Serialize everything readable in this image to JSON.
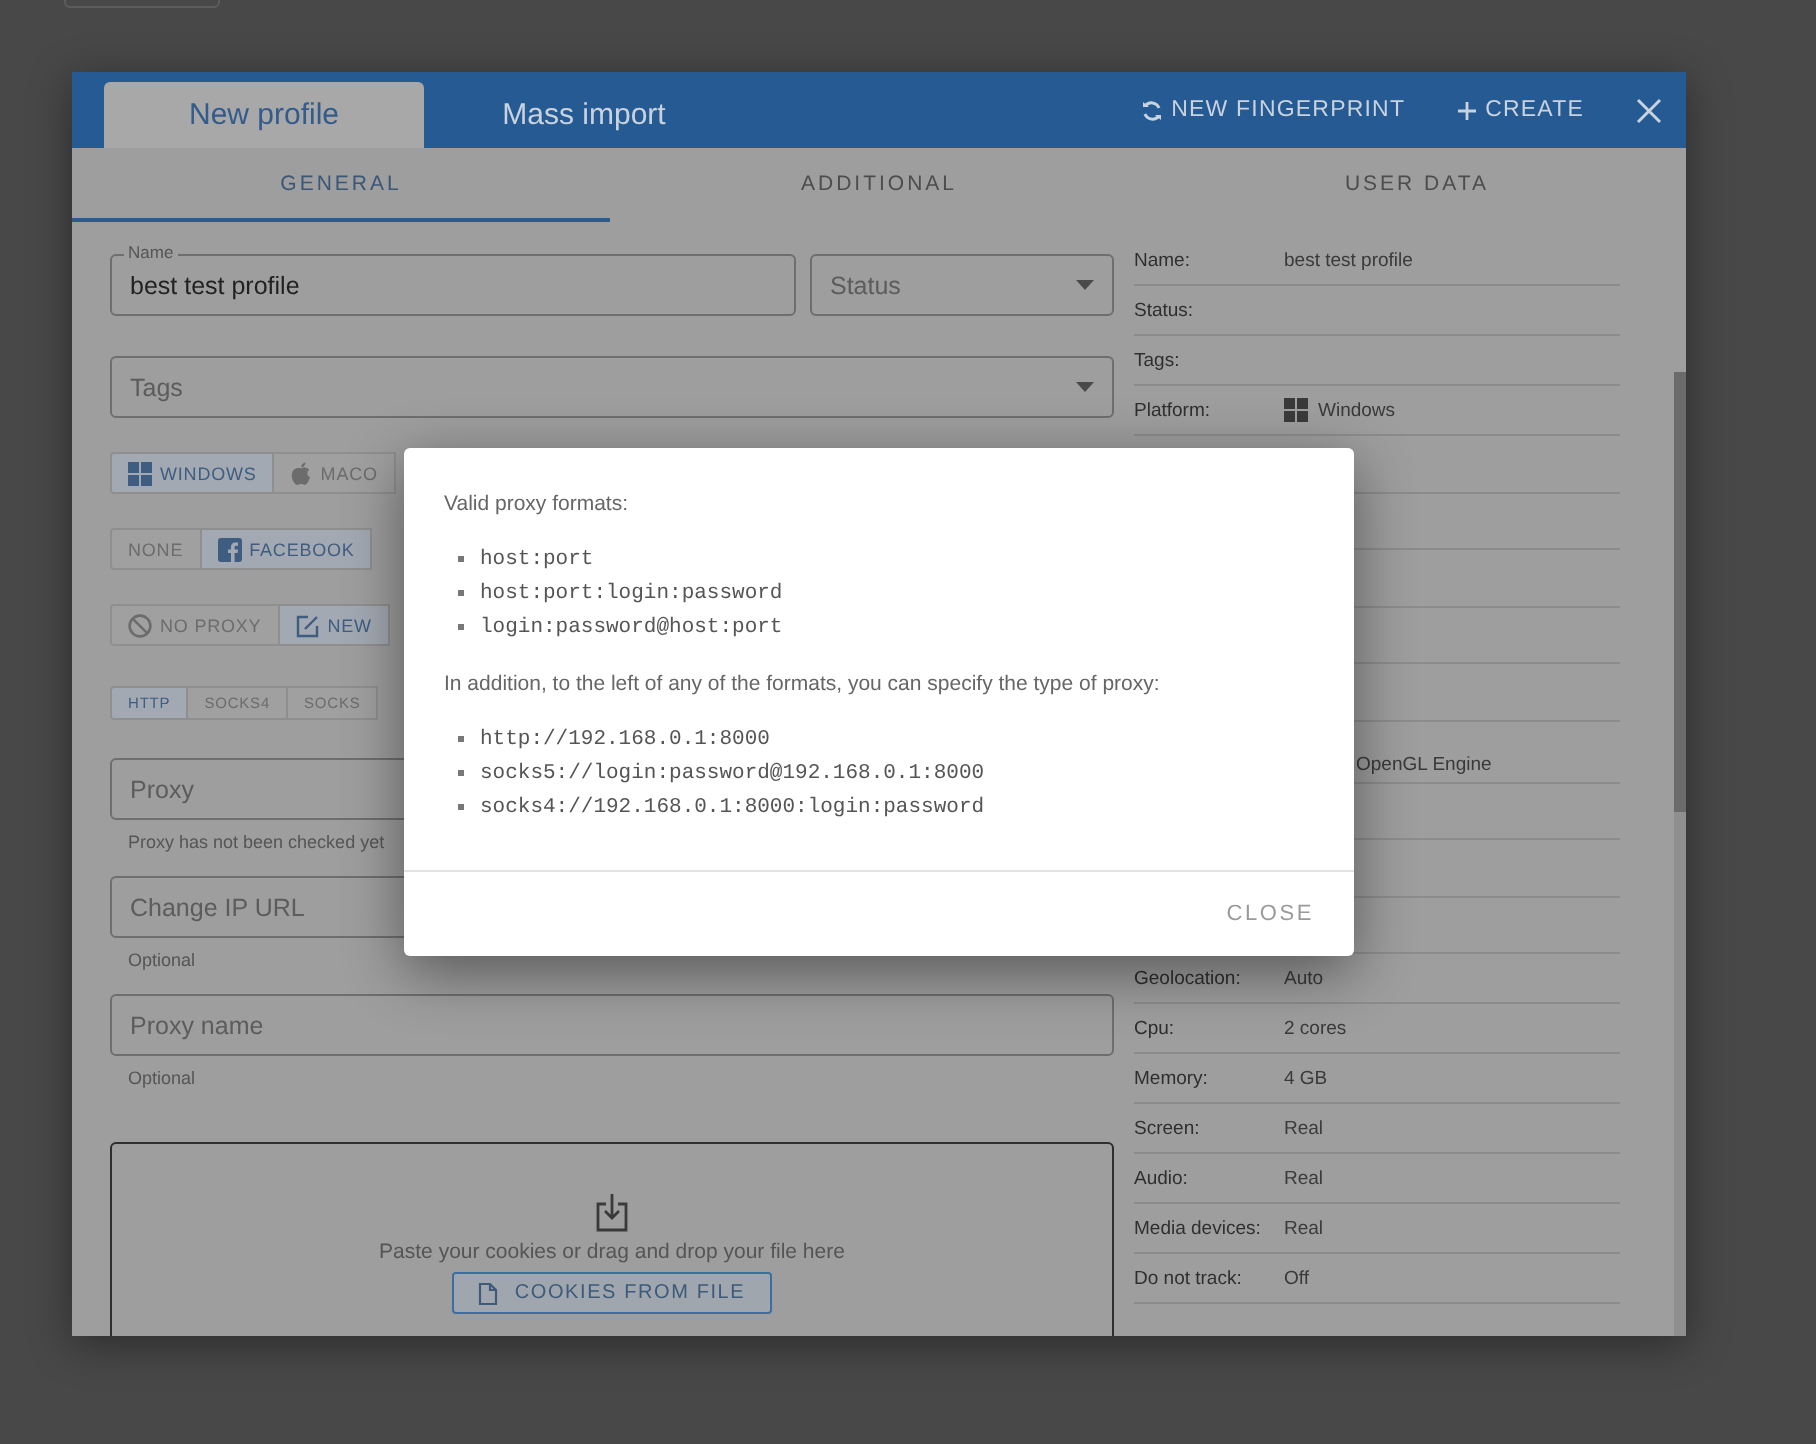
{
  "header": {
    "tabs": [
      {
        "label": "New profile",
        "selected": true
      },
      {
        "label": "Mass import",
        "selected": false
      }
    ],
    "actions": [
      {
        "kind": "fingerprint",
        "label": "NEW FINGERPRINT"
      },
      {
        "kind": "create",
        "label": "CREATE"
      }
    ]
  },
  "section_tabs": [
    {
      "label": "GENERAL",
      "selected": true
    },
    {
      "label": "ADDITIONAL",
      "selected": false
    },
    {
      "label": "USER DATA",
      "selected": false
    }
  ],
  "form": {
    "name_field": {
      "label": "Name",
      "value": "best test profile"
    },
    "status_select": {
      "placeholder": "Status"
    },
    "tags_select": {
      "placeholder": "Tags"
    },
    "toggle_groups": [
      {
        "options": [
          {
            "label": "WINDOWS",
            "selected": true
          },
          {
            "label": "MACO",
            "selected": false
          }
        ]
      },
      {
        "options": [
          {
            "label": "NONE",
            "selected": false
          },
          {
            "label": "FACEBOOK",
            "selected": true
          }
        ]
      },
      {
        "options": [
          {
            "label": "NO PROXY",
            "selected": false
          },
          {
            "label": "NEW",
            "selected": true
          }
        ]
      },
      {
        "options": [
          {
            "label": "HTTP",
            "selected": true
          },
          {
            "label": "SOCKS4",
            "selected": false
          },
          {
            "label": "SOCKS",
            "selected": false
          }
        ]
      }
    ],
    "text_fields": [
      {
        "placeholder": "Proxy",
        "helper": "Proxy has not been checked yet"
      },
      {
        "placeholder": "Change IP URL",
        "helper": "Optional"
      },
      {
        "placeholder": "Proxy name",
        "helper": "Optional"
      }
    ],
    "cookies": {
      "hint": "Paste your cookies or drag and drop your file here",
      "button": "COOKIES FROM FILE"
    }
  },
  "summary": [
    {
      "kind": "row",
      "label": "Name:",
      "value": "best test profile"
    },
    {
      "kind": "row",
      "label": "Status:"
    },
    {
      "kind": "row",
      "label": "Tags:"
    },
    {
      "kind": "platform",
      "label": "Platform:",
      "value": "Windows"
    },
    {
      "kind": "covered"
    },
    {
      "kind": "covered"
    },
    {
      "kind": "covered"
    },
    {
      "kind": "covered"
    },
    {
      "kind": "covered"
    },
    {
      "kind": "partial",
      "value": "OpenGL Engine"
    },
    {
      "kind": "covered"
    },
    {
      "kind": "covered"
    },
    {
      "kind": "covered"
    },
    {
      "kind": "row",
      "label": "Geolocation:",
      "value": "Auto"
    },
    {
      "kind": "row",
      "label": "Cpu:",
      "value": "2 cores"
    },
    {
      "kind": "row",
      "label": "Memory:",
      "value": "4 GB"
    },
    {
      "kind": "row",
      "label": "Screen:",
      "value": "Real"
    },
    {
      "kind": "row",
      "label": "Audio:",
      "value": "Real"
    },
    {
      "kind": "row",
      "label": "Media devices:",
      "value": "Real"
    },
    {
      "kind": "row",
      "label": "Do not track:",
      "value": "Off"
    }
  ],
  "dialog": {
    "intro": "Valid proxy formats:",
    "formats": [
      "host:port",
      "host:port:login:password",
      "login:password@host:port"
    ],
    "note": "In addition, to the left of any of the formats, you can specify the type of proxy:",
    "examples": [
      "http://192.168.0.1:8000",
      "socks5://login:password@192.168.0.1:8000",
      "socks4://192.168.0.1:8000:login:password"
    ],
    "button": "CLOSE"
  }
}
